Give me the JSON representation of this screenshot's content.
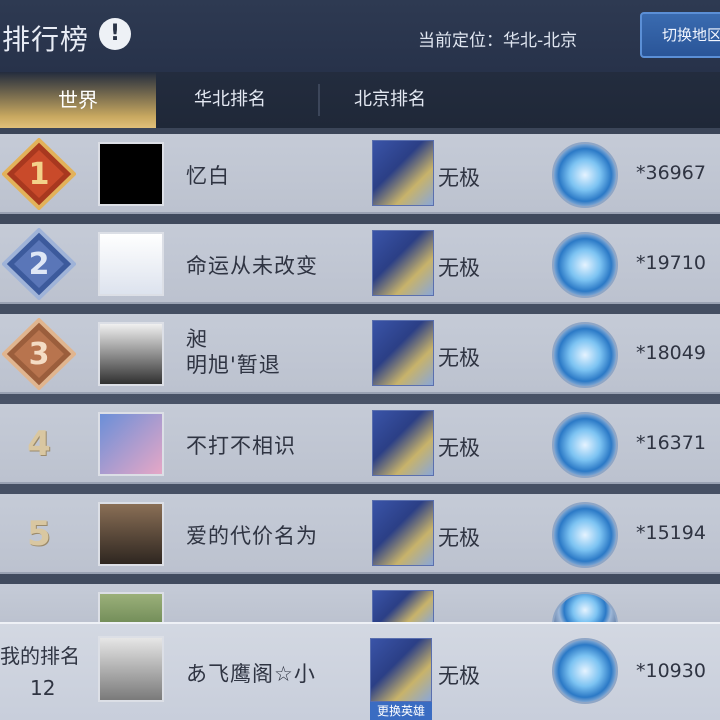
{
  "header": {
    "title": "排行榜",
    "info_icon": "!",
    "location": "当前定位：华北-北京",
    "switch_button": "切换地区"
  },
  "tabs": [
    {
      "label": "世界",
      "active": true
    },
    {
      "label": "华北排名",
      "active": false
    },
    {
      "label": "北京排名",
      "active": false
    }
  ],
  "rows": [
    {
      "rank": "1",
      "name": "忆白",
      "hero": "无极",
      "score": "*36967"
    },
    {
      "rank": "2",
      "name": "命运从未改变",
      "hero": "无极",
      "score": "*19710"
    },
    {
      "rank": "3",
      "name_line1": "昶",
      "name_line2": "明旭'暂退",
      "hero": "无极",
      "score": "*18049"
    },
    {
      "rank": "4",
      "name": "不打不相识",
      "hero": "无极",
      "score": "*16371"
    },
    {
      "rank": "5",
      "name": "爱的代价名为",
      "hero": "无极",
      "score": "*15194"
    }
  ],
  "my": {
    "label": "我的排名",
    "rank": "12",
    "name": "あ飞鹰阁☆小",
    "hero": "无极",
    "score": "*10930",
    "change_hero": "更换英雄"
  },
  "colors": {
    "rank1": "#c9472e",
    "rank2": "#5a76b8",
    "rank3": "#b8744e",
    "accent_blue": "#3a6bb0",
    "tab_gold": "#d4b46e"
  }
}
